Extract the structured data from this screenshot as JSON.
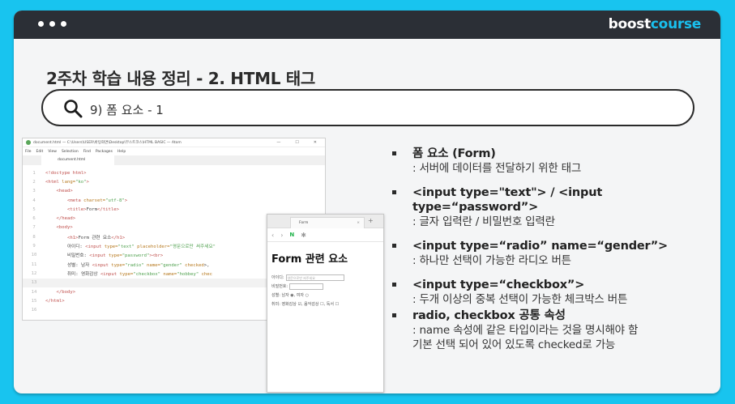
{
  "brand": {
    "part1": "boost",
    "part2": "course"
  },
  "heading": "2주차 학습 내용 정리 - 2. HTML 태그",
  "search": {
    "text": "9) 폼 요소 - 1"
  },
  "editor": {
    "title": "document.html — C:\\Users\\USER\\바탕화면\\Desktop\\부스트코스\\HTML BASIC — Atom",
    "menu": [
      "File",
      "Edit",
      "View",
      "Selection",
      "Find",
      "Packages",
      "Help"
    ],
    "tab": "document.html",
    "lines": [
      {
        "n": "1",
        "parts": [
          [
            "tag",
            "<!doctype html>"
          ]
        ]
      },
      {
        "n": "2",
        "parts": [
          [
            "tag",
            "<html "
          ],
          [
            "attr",
            "lang="
          ],
          [
            "str",
            "\"ko\""
          ],
          [
            "tag",
            ">"
          ]
        ]
      },
      {
        "n": "3",
        "parts": [
          [
            "txt",
            "    "
          ],
          [
            "tag",
            "<head>"
          ]
        ]
      },
      {
        "n": "4",
        "parts": [
          [
            "txt",
            "        "
          ],
          [
            "tag",
            "<meta "
          ],
          [
            "attr",
            "charset="
          ],
          [
            "str",
            "\"utf-8\""
          ],
          [
            "tag",
            ">"
          ]
        ]
      },
      {
        "n": "5",
        "parts": [
          [
            "txt",
            "        "
          ],
          [
            "tag",
            "<title>"
          ],
          [
            "txt",
            "Form"
          ],
          [
            "tag",
            "</title>"
          ]
        ]
      },
      {
        "n": "6",
        "parts": [
          [
            "txt",
            "    "
          ],
          [
            "tag",
            "</head>"
          ]
        ]
      },
      {
        "n": "7",
        "parts": [
          [
            "txt",
            "    "
          ],
          [
            "tag",
            "<body>"
          ]
        ]
      },
      {
        "n": "8",
        "parts": [
          [
            "txt",
            "        "
          ],
          [
            "tag",
            "<h1>"
          ],
          [
            "txt",
            "Form 관련 요소"
          ],
          [
            "tag",
            "</h1>"
          ]
        ]
      },
      {
        "n": "9",
        "parts": [
          [
            "txt",
            "        아이디: "
          ],
          [
            "tag",
            "<input "
          ],
          [
            "attr",
            "type="
          ],
          [
            "str",
            "\"text\" "
          ],
          [
            "attr",
            "placeholder="
          ],
          [
            "str",
            "\"영문으로만 써주세요\""
          ]
        ]
      },
      {
        "n": "10",
        "parts": [
          [
            "txt",
            "        비밀번호: "
          ],
          [
            "tag",
            "<input "
          ],
          [
            "attr",
            "type="
          ],
          [
            "str",
            "\"password\""
          ],
          [
            "tag",
            "><br>"
          ]
        ]
      },
      {
        "n": "11",
        "parts": [
          [
            "txt",
            "        성별: 남자 "
          ],
          [
            "tag",
            "<input "
          ],
          [
            "attr",
            "type="
          ],
          [
            "str",
            "\"radio\" "
          ],
          [
            "attr",
            "name="
          ],
          [
            "str",
            "\"gender\" "
          ],
          [
            "attr",
            "checked"
          ],
          [
            "txt",
            ">,"
          ]
        ]
      },
      {
        "n": "12",
        "parts": [
          [
            "txt",
            "        취미: 영화감상 "
          ],
          [
            "tag",
            "<input "
          ],
          [
            "attr",
            "type="
          ],
          [
            "str",
            "\"checkbox\" "
          ],
          [
            "attr",
            "name="
          ],
          [
            "str",
            "\"hobbey\" "
          ],
          [
            "attr",
            "chec"
          ]
        ]
      },
      {
        "n": "13",
        "parts": []
      },
      {
        "n": "14",
        "parts": [
          [
            "txt",
            "    "
          ],
          [
            "tag",
            "</body>"
          ]
        ]
      },
      {
        "n": "15",
        "parts": [
          [
            "tag",
            "</html>"
          ]
        ]
      },
      {
        "n": "16",
        "parts": []
      }
    ]
  },
  "preview": {
    "tab_title": "Form",
    "h1": "Form 관련 요소",
    "id_label": "아이디:",
    "id_placeholder": "영문으로만 써주세요",
    "pw_label": "비밀번호:",
    "gender_row": "성별: 남자 ◉, 여자 ○",
    "hobby_row": "취미: 영화감상 ☑, 음악감상 ☐, 독서 ☐"
  },
  "notes": [
    {
      "title": "폼 요소 (Form)",
      "desc": ": 서버에 데이터를 전달하기 위한 태그"
    },
    {
      "title": "<input type=\"text\"> / <input type=“password”>",
      "desc": ": 글자 입력란 / 비밀번호 입력란"
    },
    {
      "title": "<input type=“radio” name=“gender”>",
      "desc": ": 하나만 선택이 가능한 라디오 버튼"
    },
    {
      "title": "<input type=“checkbox”>",
      "desc": ": 두개 이상의 중복 선택이 가능한 체크박스 버튼"
    },
    {
      "title": "radio, checkbox 공통 속성",
      "desc": ": name 속성에 같은 타입이라는 것을 명시해야 함",
      "desc2": "기본 선택 되어 있어 있도록 checked로 가능"
    }
  ]
}
